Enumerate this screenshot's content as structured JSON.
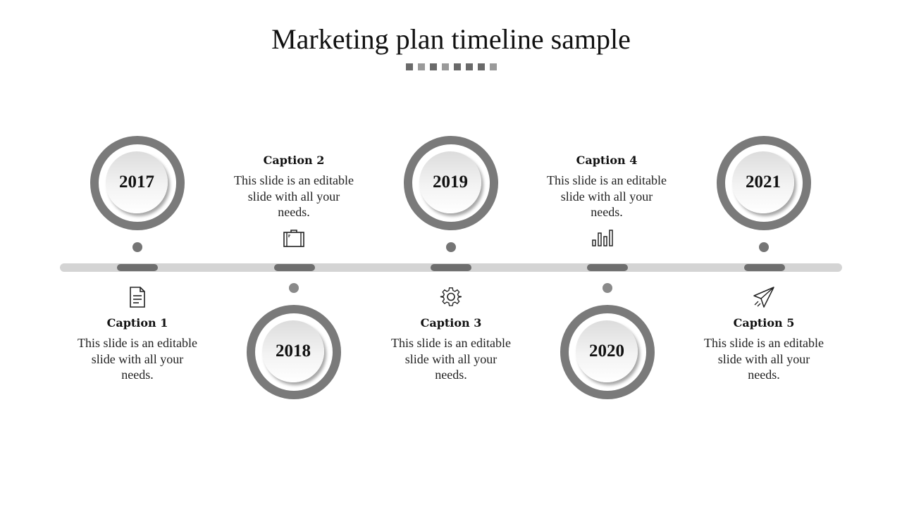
{
  "title": "Marketing plan timeline sample",
  "decor_square_colors": [
    "#6a6a6a",
    "#9a9a9a",
    "#6a6a6a",
    "#9a9a9a",
    "#6a6a6a",
    "#6a6a6a",
    "#6a6a6a",
    "#9a9a9a"
  ],
  "colors": {
    "ring": "#7a7a7a",
    "track": "#d4d4d4",
    "segment": "#6e6e6e",
    "dot": "#757575",
    "dot_light": "#8a8a8a"
  },
  "milestones": [
    {
      "year": "2017",
      "caption": "Caption 1",
      "text": "This slide is an editable slide with all your needs.",
      "icon": "document-icon",
      "position": "top"
    },
    {
      "year": "2018",
      "caption": "Caption 2",
      "text": "This slide is an editable slide with all your needs.",
      "icon": "briefcase-icon",
      "position": "bottom"
    },
    {
      "year": "2019",
      "caption": "Caption 3",
      "text": "This slide is an editable slide with all your needs.",
      "icon": "gear-icon",
      "position": "top"
    },
    {
      "year": "2020",
      "caption": "Caption 4",
      "text": "This slide is an editable slide with all your needs.",
      "icon": "bar-chart-icon",
      "position": "bottom"
    },
    {
      "year": "2021",
      "caption": "Caption 5",
      "text": "This slide is an editable slide with all your needs.",
      "icon": "paper-plane-icon",
      "position": "top"
    }
  ]
}
